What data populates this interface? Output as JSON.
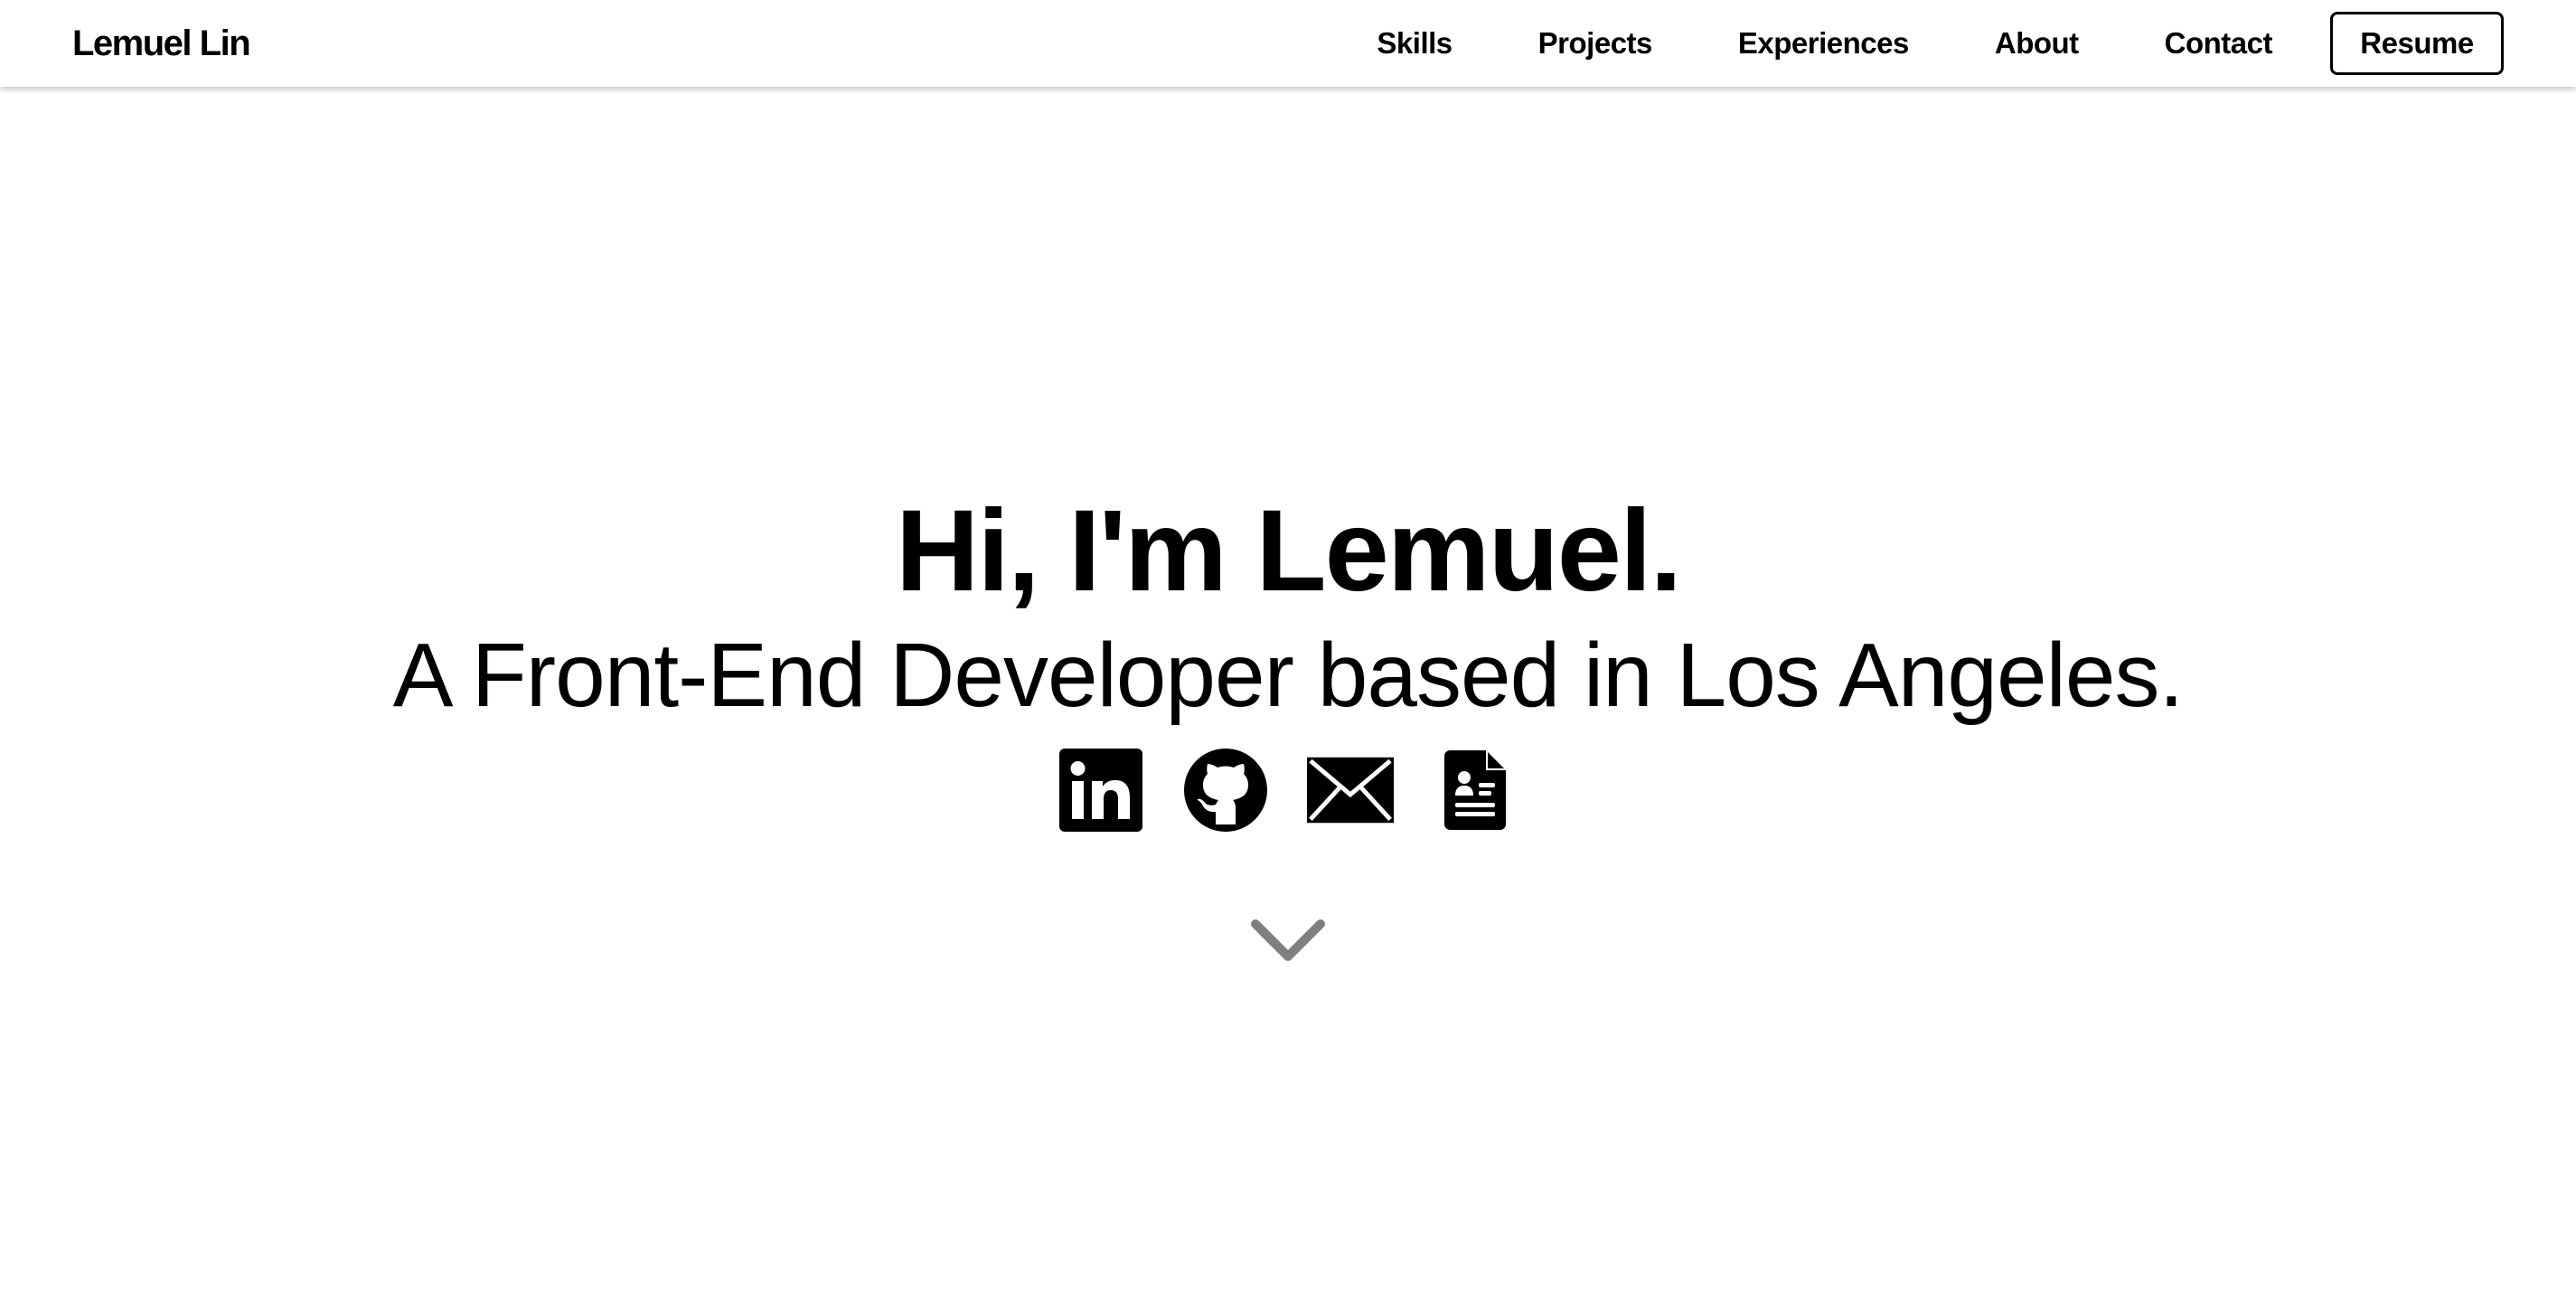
{
  "header": {
    "brand": "Lemuel Lin",
    "nav": [
      {
        "label": "Skills"
      },
      {
        "label": "Projects"
      },
      {
        "label": "Experiences"
      },
      {
        "label": "About"
      },
      {
        "label": "Contact"
      }
    ],
    "resume_label": "Resume"
  },
  "hero": {
    "title": "Hi, I'm Lemuel.",
    "subtitle": "A Front-End Developer based in Los Angeles.",
    "social_icons": [
      "linkedin-icon",
      "github-icon",
      "email-icon",
      "resume-document-icon"
    ],
    "scroll_icon": "chevron-down-icon"
  },
  "colors": {
    "background": "#ffffff",
    "text": "#000000",
    "chevron": "#7f7f7f"
  }
}
